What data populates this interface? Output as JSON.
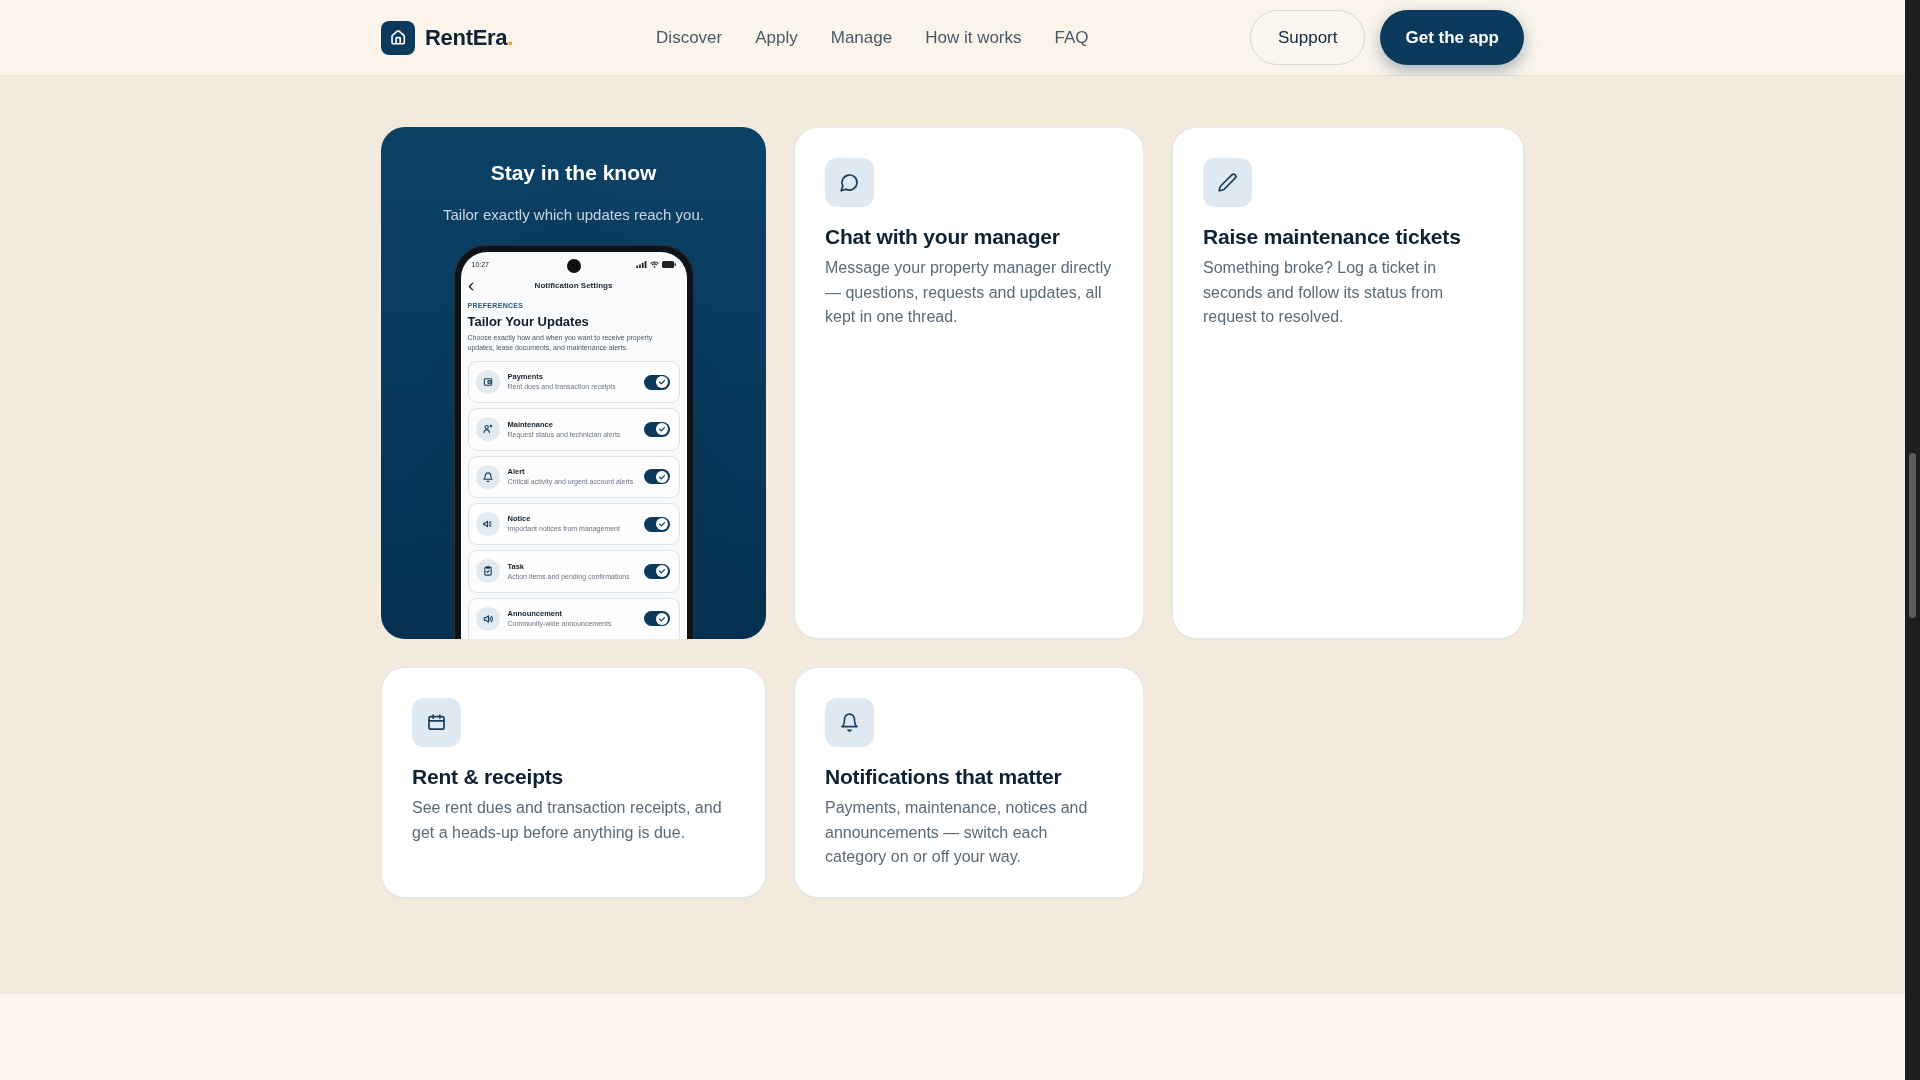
{
  "header": {
    "brand": {
      "name": "RentEra",
      "dot": "."
    },
    "nav": [
      {
        "label": "Discover"
      },
      {
        "label": "Apply"
      },
      {
        "label": "Manage"
      },
      {
        "label": "How it works"
      },
      {
        "label": "FAQ"
      }
    ],
    "actions": [
      {
        "label": "Support",
        "kind": "outline"
      },
      {
        "label": "Get the app",
        "kind": "primary"
      }
    ]
  },
  "features": [
    {
      "kind": "showcase",
      "title": "Stay in the know",
      "subtitle": "Tailor exactly which updates reach you.",
      "phone": {
        "time": "10:27",
        "screen_title": "Notification Settings",
        "eyebrow": "PREFERENCES",
        "heading": "Tailor Your Updates",
        "intro": "Choose exactly how and when you want to receive property updates, lease documents, and maintenance alerts.",
        "settings": [
          {
            "title": "Payments",
            "description": "Rent dues and transaction receipts",
            "on": true
          },
          {
            "title": "Maintenance",
            "description": "Request status and technician alerts",
            "on": true
          },
          {
            "title": "Alert",
            "description": "Critical activity and urgent account alerts",
            "on": true
          },
          {
            "title": "Notice",
            "description": "Important notices from management",
            "on": true
          },
          {
            "title": "Task",
            "description": "Action items and pending confirmations",
            "on": true
          },
          {
            "title": "Announcement",
            "description": "Community-wide announcements",
            "on": true
          }
        ]
      }
    },
    {
      "kind": "feature",
      "title": "Chat with your manager",
      "description": "Message your property manager directly — questions, requests and updates, all kept in one thread."
    },
    {
      "kind": "feature",
      "title": "Raise maintenance tickets",
      "description": "Something broke? Log a ticket in seconds and follow its status from request to resolved."
    },
    {
      "kind": "feature",
      "title": "Rent & receipts",
      "description": "See rent dues and transaction receipts, and get a heads-up before anything is due."
    },
    {
      "kind": "feature",
      "title": "Notifications that matter",
      "description": "Payments, maintenance, notices and announcements — switch each category on or off your way."
    }
  ]
}
